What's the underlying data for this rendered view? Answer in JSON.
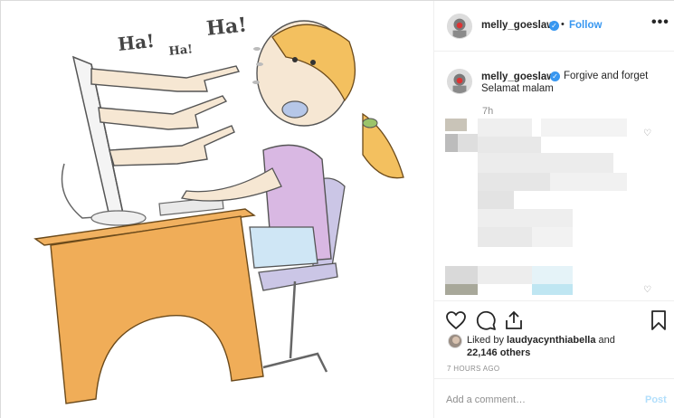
{
  "post": {
    "author": {
      "username": "melly_goeslaw",
      "verified": true,
      "verified_icon": "verified-check-icon"
    },
    "follow_label": "Follow",
    "more_label": "•••",
    "caption": {
      "username": "melly_goeslaw",
      "text_line1": "Forgive and forget",
      "text_line2": "Selamat malam",
      "time": "7h"
    },
    "media": {
      "speech_bubbles": [
        "Ha!",
        "Ha!",
        "Ha!"
      ]
    },
    "likes": {
      "prefix": "Liked by",
      "liked_by_user": "laudyacynthiabella",
      "and": "and",
      "count": "22,146 others"
    },
    "timestamp": "7 HOURS AGO",
    "comment": {
      "placeholder": "Add a comment…",
      "post_label": "Post"
    }
  },
  "icons": {
    "like": "heart-icon",
    "comment": "comment-icon",
    "share": "share-icon",
    "save": "bookmark-icon",
    "more": "more-options-icon"
  },
  "colors": {
    "link_blue": "#3897f0",
    "post_disabled": "#b2dffc",
    "muted_text": "#8e8e8e",
    "border": "#dbdbdb"
  }
}
